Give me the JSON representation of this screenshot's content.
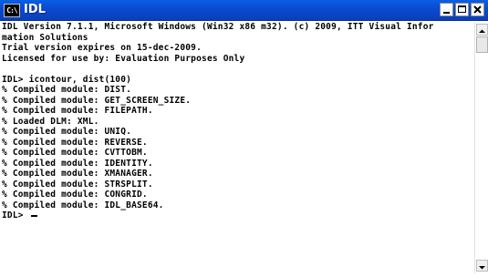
{
  "window": {
    "title": "IDL",
    "icon_text": "C:\\",
    "buttons": {
      "minimize": "minimize-icon",
      "maximize": "maximize-icon",
      "close": "close-icon"
    }
  },
  "console": {
    "lines": [
      "IDL Version 7.1.1, Microsoft Windows (Win32 x86 m32). (c) 2009, ITT Visual Infor",
      "mation Solutions",
      "Trial version expires on 15-dec-2009.",
      "Licensed for use by: Evaluation Purposes Only",
      "",
      "IDL> icontour, dist(100)",
      "% Compiled module: DIST.",
      "% Compiled module: GET_SCREEN_SIZE.",
      "% Compiled module: FILEPATH.",
      "% Loaded DLM: XML.",
      "% Compiled module: UNIQ.",
      "% Compiled module: REVERSE.",
      "% Compiled module: CVTTOBM.",
      "% Compiled module: IDENTITY.",
      "% Compiled module: XMANAGER.",
      "% Compiled module: STRSPLIT.",
      "% Compiled module: CONGRID.",
      "% Compiled module: IDL_BASE64."
    ],
    "prompt": "IDL> "
  },
  "scrollbar": {
    "up_icon": "scroll-up-arrow-icon",
    "down_icon": "scroll-down-arrow-icon"
  },
  "colors": {
    "titlebar": "#0a52dc",
    "text": "#000000",
    "background": "#ffffff"
  }
}
